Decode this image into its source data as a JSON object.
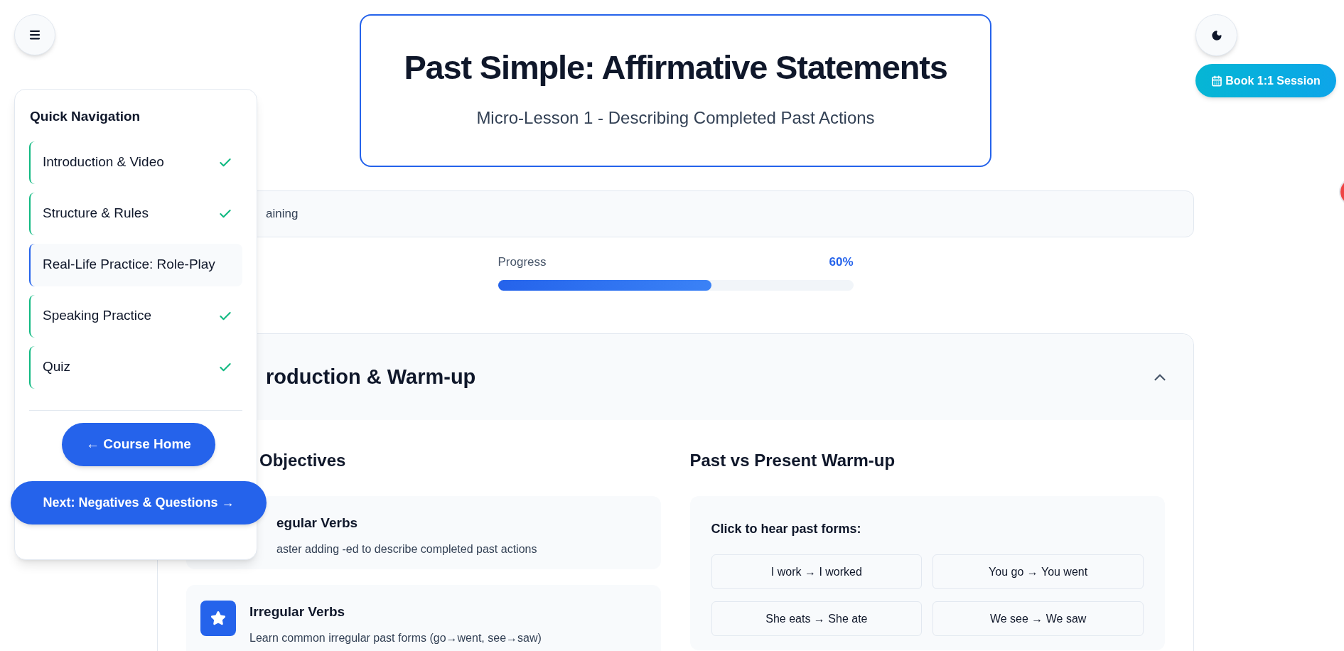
{
  "header": {
    "title": "Past Simple: Affirmative Statements",
    "subtitle": "Micro-Lesson 1 - Describing Completed Past Actions"
  },
  "book_button": {
    "label": "Book 1:1 Session"
  },
  "status": {
    "text": "aining"
  },
  "progress": {
    "label": "Progress",
    "value": "60%",
    "level": 0.6
  },
  "nav": {
    "title": "Quick Navigation",
    "items": [
      {
        "label": "Introduction & Video",
        "done": true,
        "selected": false
      },
      {
        "label": "Structure & Rules",
        "done": true,
        "selected": false
      },
      {
        "label": "Real-Life Practice: Role-Play",
        "done": false,
        "selected": true
      },
      {
        "label": "Speaking Practice",
        "done": true,
        "selected": false
      },
      {
        "label": "Quiz",
        "done": true,
        "selected": false
      }
    ],
    "home_button": "← Course Home",
    "next_button": "Next: Negatives & Questions →"
  },
  "section": {
    "title": "roduction & Warm-up",
    "expanded": true
  },
  "objectives": {
    "heading": "Objectives",
    "items": [
      {
        "kind": "plain",
        "title": "egular Verbs",
        "description": "aster adding -ed to describe completed past actions"
      },
      {
        "kind": "starred",
        "title": "Irregular Verbs",
        "description": "Learn common irregular past forms (go→went, see→saw)"
      }
    ]
  },
  "warmup": {
    "heading": "Past vs Present Warm-up",
    "prompt": "Click to hear past forms:",
    "pairs": [
      "I work → I worked",
      "You go → You went",
      "She eats → She ate",
      "We see → We saw"
    ]
  }
}
